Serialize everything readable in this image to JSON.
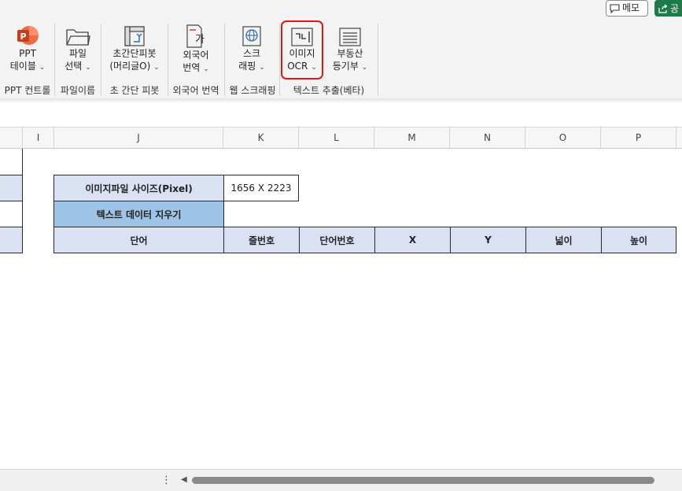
{
  "topbar": {
    "memo_label": "메모",
    "share_label": "공"
  },
  "ribbon": {
    "buttons": [
      {
        "line1": "PPT",
        "line2": "테이블"
      },
      {
        "line1": "파일",
        "line2": "선택"
      },
      {
        "line1": "초간단피봇",
        "line2": "(머리글O)"
      },
      {
        "line1": "외국어",
        "line2": "번역"
      },
      {
        "line1": "스크",
        "line2": "래핑"
      },
      {
        "line1": "이미지",
        "line2": "OCR"
      },
      {
        "line1": "부동산",
        "line2": "등기부"
      }
    ],
    "groups": [
      "PPT 컨트롤",
      "파일이름",
      "초 간단 피봇",
      "외국어 번역",
      "웹 스크래핑",
      "텍스트 추출(베타)"
    ],
    "translate_glyph": "가",
    "chevron": "⌄"
  },
  "columns": [
    "I",
    "J",
    "K",
    "L",
    "M",
    "N",
    "O",
    "P"
  ],
  "sheet": {
    "image_size_label": "이미지파일 사이즈(Pixel)",
    "image_size_value": "1656 X 2223",
    "clear_button": "텍스트 데이터 지우기",
    "table_headers": [
      "단어",
      "줄번호",
      "단어번호",
      "X",
      "Y",
      "넓이",
      "높이"
    ]
  },
  "bottom": {
    "more_glyph": "⋮",
    "scroll_left_glyph": "◀"
  },
  "colors": {
    "header_fill": "#d9e1f2",
    "button_fill": "#9dc3e6",
    "highlight": "#e01818",
    "share_green": "#1e7a46"
  }
}
